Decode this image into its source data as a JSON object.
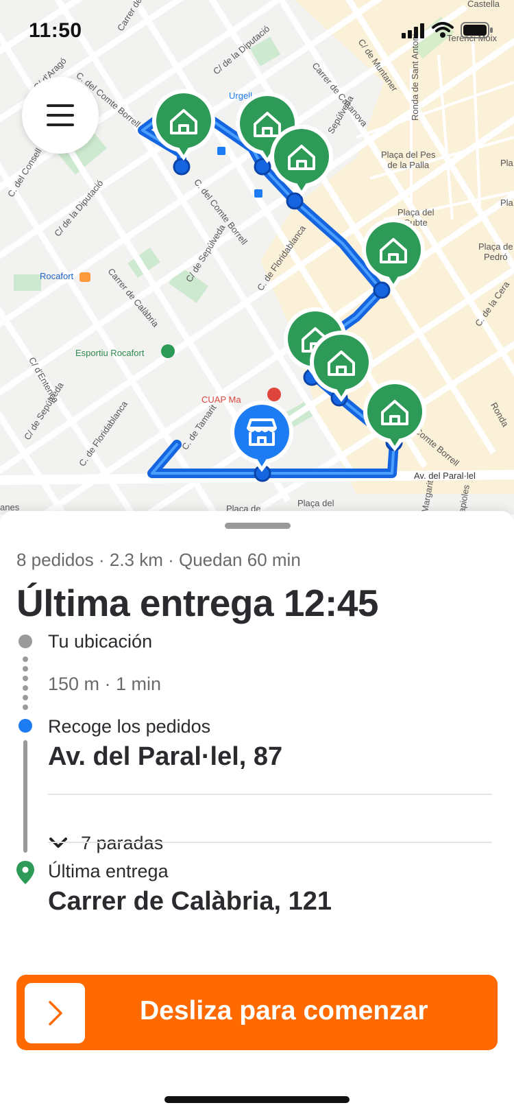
{
  "status_bar": {
    "time": "11:50"
  },
  "colors": {
    "accent": "#ff6a00",
    "route": "#1565e0",
    "pin_green": "#2e9a57",
    "store_blue": "#1e7cf2"
  },
  "map": {
    "labels": {
      "castella": "Castella",
      "teren_moix": "Terenci Moix",
      "comte_urgell": "Carrer del Comte d'Urgell",
      "diputacio_top": "C/ de la Diputació",
      "arago": "C/ d'Aragó",
      "comte_borrell_1": "C. del Comte Borrell",
      "urgell": "Urgell",
      "muntaner": "C/ de Muntaner",
      "casanova": "Carrer de Casanova",
      "sepulveda_1": "Sepúlveda",
      "ronda_sant_antoni": "Ronda de Sant Antoni",
      "placa_pes_palla": "Plaça del Pes\nde la Palla",
      "consell_cent": "C. del Consell de Cent",
      "diputacio_left": "C/ de la Diputació",
      "comte_borrell_2": "C. del Comte Borrell",
      "sepulveda_2": "C/ de Sepúlveda",
      "floridablanca_1": "C. de Floridablanca",
      "placa_subte": "Plaça del\nSubte",
      "placa_pedro": "Plaça de\nPedró",
      "rocafort": "Rocafort",
      "calabria": "Carrer de Calàbria",
      "la_cera": "C. de la Cera",
      "esportiu_rocafort": "Esportiu Rocafort",
      "entenca": "C/ d'Entença",
      "sepulveda_3": "C/ de Sepúlveda",
      "floridablanca_2": "C. de Floridablanca",
      "tamarit": "C. de Tamarit",
      "cuap": "CUAP Ma",
      "comte_borrell_3": "Comte Borrell",
      "av_parallel": "Av. del Paral·lel",
      "placa_bottom_1": "Plaça del",
      "placa_bottom_2": "Plaça de",
      "anes": "anes",
      "margarit": "Margarit",
      "apioles": "apioles",
      "pla": "Pla",
      "pla2": "Pla",
      "ronda": "Ronda"
    },
    "menu_icon": "hamburger-menu-icon",
    "pin_icon": "house-icon",
    "store_icon": "store-icon"
  },
  "sheet": {
    "summary": "8 pedidos · 2.3 km · Quedan 60 min",
    "headline": "Última entrega 12:45",
    "timeline": {
      "current_location": "Tu ubicación",
      "distance_time": "150 m · 1 min",
      "pickup_label": "Recoge los pedidos",
      "pickup_address": "Av. del Paral·lel, 87",
      "stops_label": "7 paradas",
      "last_label": "Última entrega",
      "last_address": "Carrer de Calàbria, 121"
    },
    "slide_button": {
      "label": "Desliza para comenzar",
      "icon": "chevron-right-icon"
    }
  }
}
